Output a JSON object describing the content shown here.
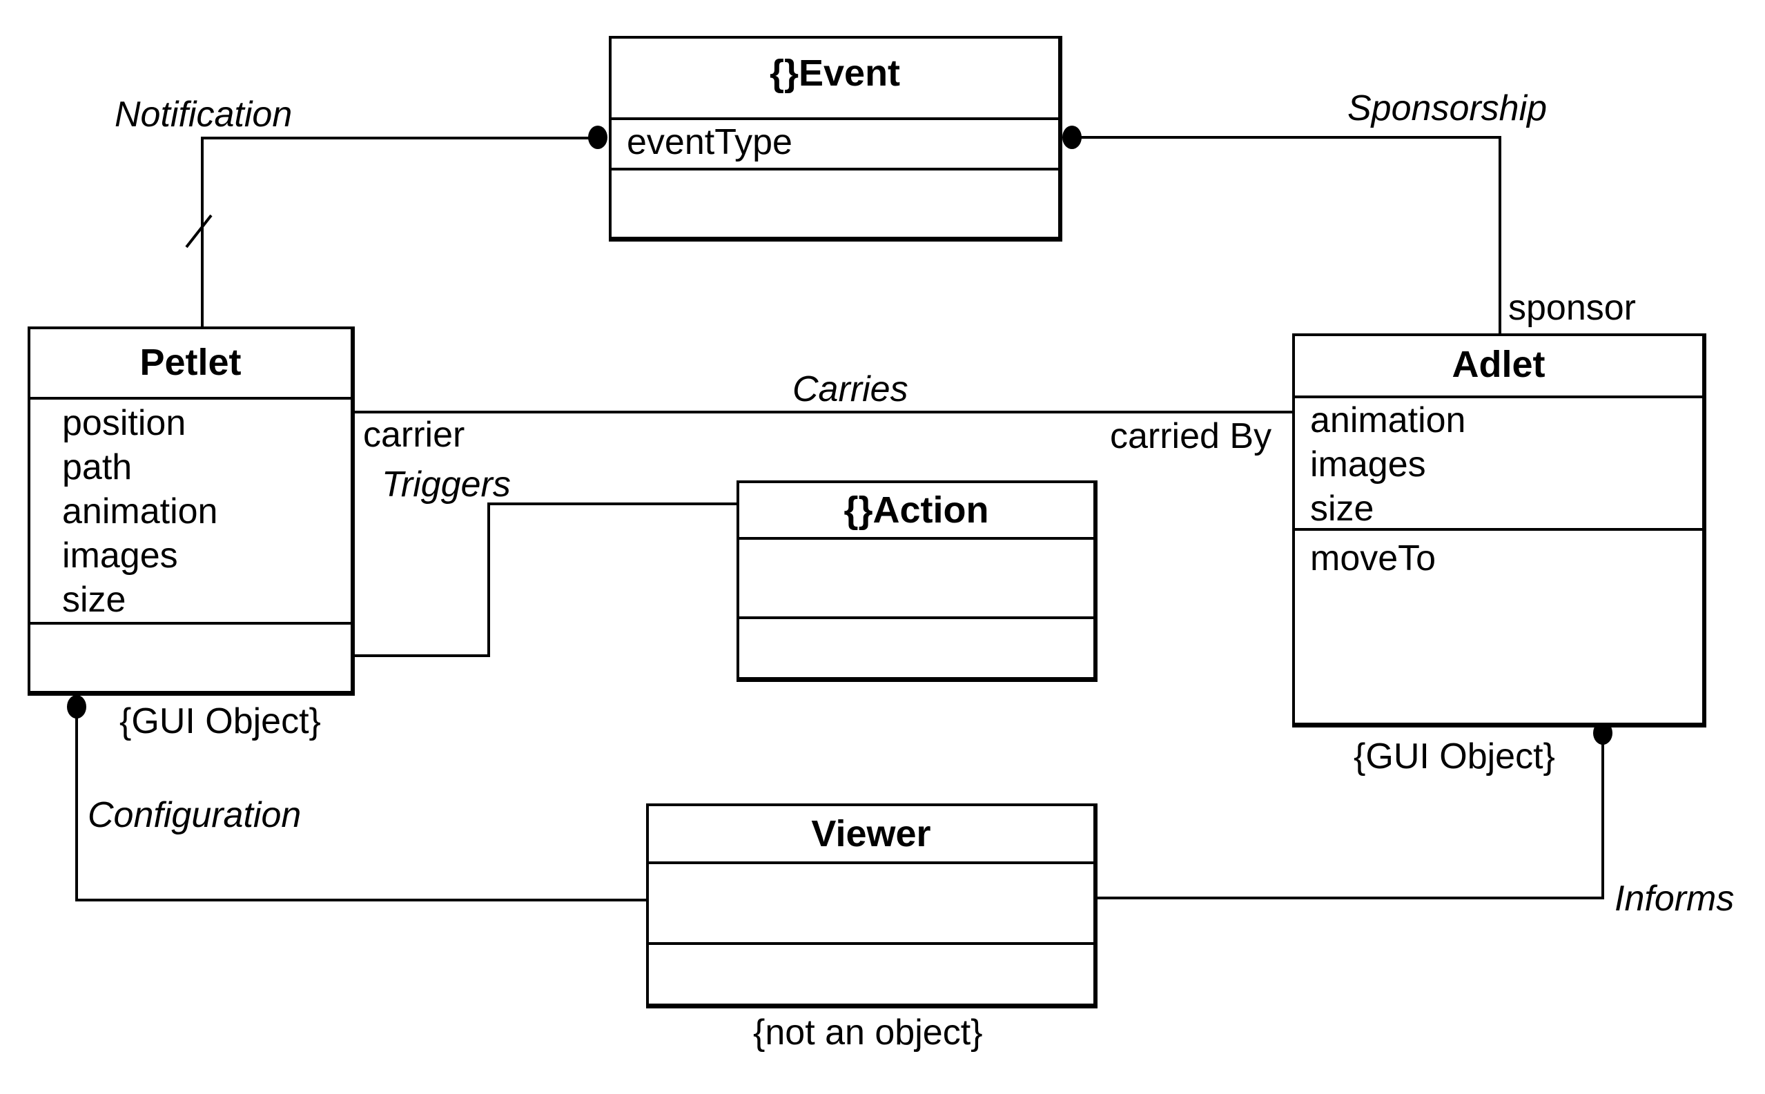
{
  "diagram": {
    "type": "UML class diagram",
    "classes": {
      "event": {
        "name": "{}Event",
        "attributes": [
          "eventType"
        ],
        "operations": []
      },
      "petlet": {
        "name": "Petlet",
        "attributes": [
          "position",
          "path",
          "animation",
          "images",
          "size"
        ],
        "operations": [],
        "constraint": "{GUI Object}"
      },
      "action": {
        "name": "{}Action",
        "attributes": [],
        "operations": []
      },
      "adlet": {
        "name": "Adlet",
        "attributes": [
          "animation",
          "images",
          "size"
        ],
        "operations": [
          "moveTo"
        ],
        "constraint": "{GUI Object}"
      },
      "viewer": {
        "name": "Viewer",
        "attributes": [],
        "operations": [],
        "constraint": "{not an object}"
      }
    },
    "associations": {
      "notification": {
        "name": "Notification",
        "from": "Petlet",
        "to": "Event"
      },
      "sponsorship": {
        "name": "Sponsorship",
        "from": "Adlet",
        "to": "Event",
        "role": "sponsor"
      },
      "carries": {
        "name": "Carries",
        "from": "Petlet",
        "to": "Adlet",
        "role_from": "carrier",
        "role_to": "carried By"
      },
      "triggers": {
        "name": "Triggers",
        "from": "Petlet",
        "to": "Action"
      },
      "configuration": {
        "name": "Configuration",
        "from": "Petlet",
        "to": "Viewer"
      },
      "informs": {
        "name": "Informs",
        "from": "Viewer",
        "to": "Adlet"
      }
    }
  }
}
